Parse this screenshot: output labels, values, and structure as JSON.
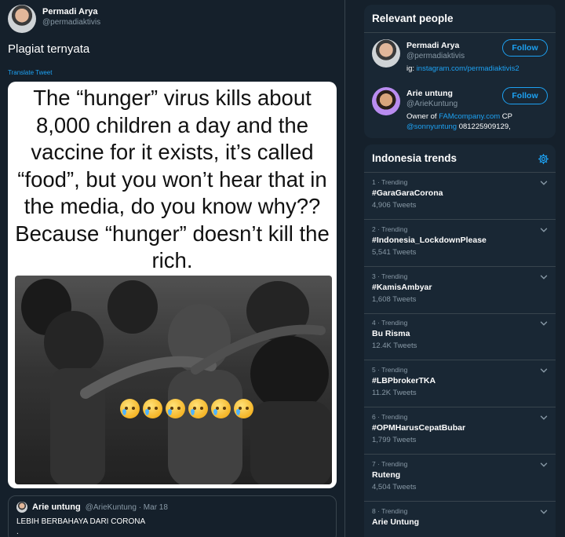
{
  "tweet": {
    "author_name": "Permadi Arya",
    "author_handle": "@permadiaktivis",
    "text": "Plagiat ternyata",
    "translate_label": "Translate Tweet",
    "image_text": "The “hunger” virus kills about 8,000 children a day and the vaccine for it exists, it’s called “food”, but you won’t hear that in the media, do you know why?? Because “hunger” doesn’t kill the rich.",
    "image_emoji": "crying-face-emoji x6"
  },
  "quoted": {
    "name": "Arie untung",
    "meta": "@ArieKuntung · Mar 18",
    "text": "LEBIH BERBAHAYA DARI CORONA",
    "dot": "."
  },
  "relevant_people": {
    "title": "Relevant people",
    "people": [
      {
        "name": "Permadi Arya",
        "handle": "@permadiaktivis",
        "bio_prefix": "ig: ",
        "bio_link": "instagram.com/permadiaktivis2",
        "follow_label": "Follow"
      },
      {
        "name": "Arie untung",
        "handle": "@ArieKuntung",
        "bio_line1_prefix": "Owner of ",
        "bio_line1_link": "FAMcompany.com",
        "bio_line1_suffix": " CP",
        "bio_line2_link": "@sonnyuntung",
        "bio_line2_suffix": " 081225909129,",
        "follow_label": "Follow"
      }
    ]
  },
  "trends": {
    "title": "Indonesia trends",
    "items": [
      {
        "meta": "1 · Trending",
        "name": "#GaraGaraCorona",
        "count": "4,906 Tweets"
      },
      {
        "meta": "2 · Trending",
        "name": "#Indonesia_LockdownPlease",
        "count": "5,541 Tweets"
      },
      {
        "meta": "3 · Trending",
        "name": "#KamisAmbyar",
        "count": "1,608 Tweets"
      },
      {
        "meta": "4 · Trending",
        "name": "Bu Risma",
        "count": "12.4K Tweets"
      },
      {
        "meta": "5 · Trending",
        "name": "#LBPbrokerTKA",
        "count": "11.2K Tweets"
      },
      {
        "meta": "6 · Trending",
        "name": "#OPMHarusCepatBubar",
        "count": "1,799 Tweets"
      },
      {
        "meta": "7 · Trending",
        "name": "Ruteng",
        "count": "4,504 Tweets"
      },
      {
        "meta": "8 · Trending",
        "name": "Arie Untung",
        "count": ""
      }
    ]
  },
  "colors": {
    "background": "#15202b",
    "panel": "#192734",
    "accent": "#1da1f2",
    "muted": "#8899a6",
    "border": "#38444d"
  },
  "icons": {
    "settings": "gear-icon",
    "caret": "chevron-down-icon"
  }
}
